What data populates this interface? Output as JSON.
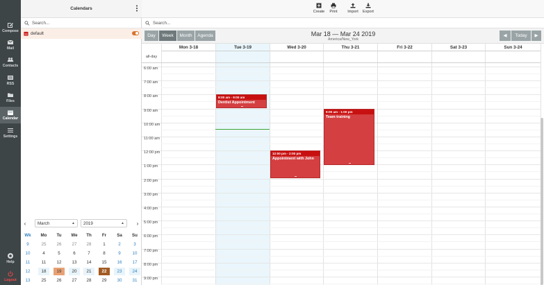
{
  "nav": {
    "compose": "Compose",
    "mail": "Mail",
    "contacts": "Contacts",
    "rss": "RSS",
    "files": "Files",
    "calendar": "Calendar",
    "settings": "Settings",
    "help": "Help",
    "logout": "Logout"
  },
  "sidebar": {
    "title": "Calendars",
    "search_placeholder": "Search...",
    "calendars": [
      {
        "name": "default",
        "enabled": true,
        "color": "#c81010"
      }
    ]
  },
  "mini_calendar": {
    "month": "March",
    "year": "2019",
    "headers": [
      "Wk",
      "Mo",
      "Tu",
      "We",
      "Th",
      "Fr",
      "Sa",
      "Su"
    ],
    "weeks": [
      {
        "wk": "9",
        "days": [
          "25",
          "26",
          "27",
          "28",
          "1",
          "2",
          "3"
        ]
      },
      {
        "wk": "10",
        "days": [
          "4",
          "5",
          "6",
          "7",
          "8",
          "9",
          "10"
        ]
      },
      {
        "wk": "11",
        "days": [
          "11",
          "12",
          "13",
          "14",
          "15",
          "16",
          "17"
        ]
      },
      {
        "wk": "12",
        "days": [
          "18",
          "19",
          "20",
          "21",
          "22",
          "23",
          "24"
        ]
      },
      {
        "wk": "13",
        "days": [
          "25",
          "26",
          "27",
          "28",
          "29",
          "30",
          "31"
        ]
      }
    ]
  },
  "toolbar": {
    "create": "Create",
    "print": "Print",
    "import": "Import",
    "export": "Export"
  },
  "main": {
    "search_placeholder": "Search...",
    "views": [
      "Day",
      "Week",
      "Month",
      "Agenda"
    ],
    "active_view": "Week",
    "range_title": "Mar 18 — Mar 24 2019",
    "timezone": "America/New_York",
    "today_label": "Today",
    "prev_icon": "chevron-left-icon",
    "next_icon": "chevron-right-icon"
  },
  "week": {
    "days": [
      "Mon 3-18",
      "Tue 3-19",
      "Wed 3-20",
      "Thu 3-21",
      "Fri 3-22",
      "Sat 3-23",
      "Sun 3-24"
    ],
    "allday_label": "all-day",
    "time_labels": [
      "6:00 am",
      "7:00 am",
      "8:00 am",
      "9:00 am",
      "10:00 am",
      "11:00 am",
      "12:00 pm",
      "1:00 pm",
      "2:00 pm",
      "3:00 pm",
      "4:00 pm",
      "5:00 pm",
      "6:00 pm",
      "7:00 pm",
      "8:00 pm",
      "9:00 pm"
    ],
    "events": [
      {
        "day": 1,
        "start": 8,
        "end": 9,
        "time": "8:00 am - 9:00 am",
        "title": "Dentist Appointment"
      },
      {
        "day": 2,
        "start": 12,
        "end": 14,
        "time": "12:00 pm - 2:00 pm",
        "title": "Appointment with John"
      },
      {
        "day": 3,
        "start": 9,
        "end": 13,
        "time": "9:00 am - 1:00 pm",
        "title": "Team training"
      }
    ]
  },
  "colors": {
    "accent": "#d9732f",
    "event": "#d43f41",
    "event_header": "#c81010",
    "nav_bg": "#3e4547",
    "now_line": "#36a537"
  }
}
